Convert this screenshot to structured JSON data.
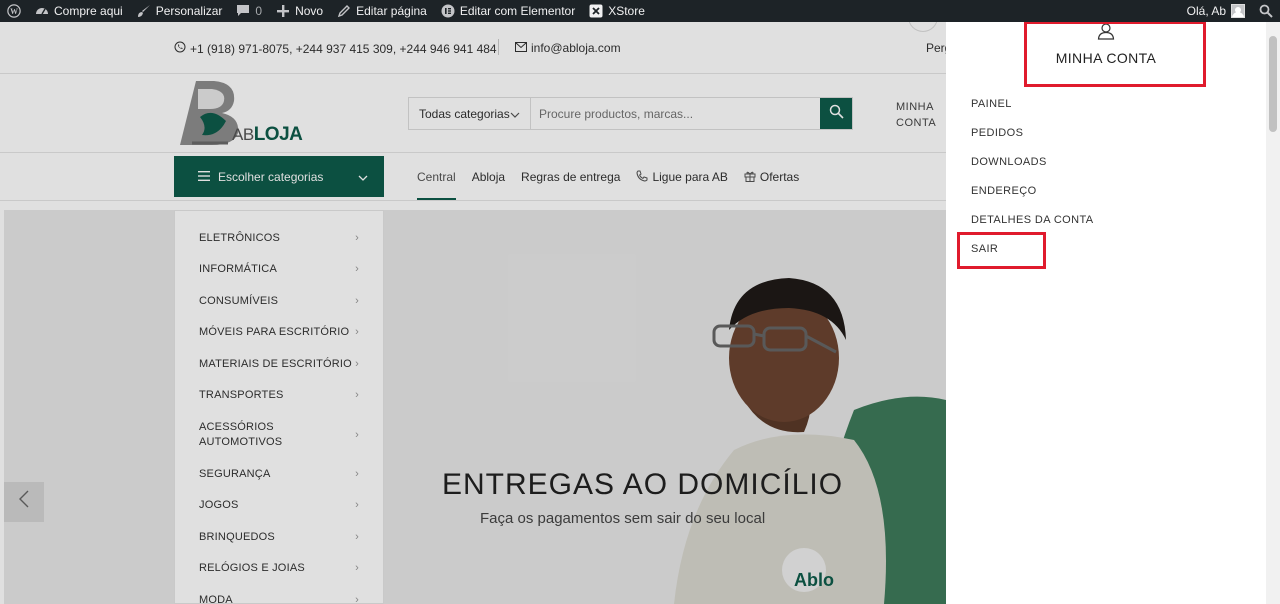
{
  "adminbar": {
    "items": [
      {
        "label": "",
        "icon": "wordpress-icon"
      },
      {
        "label": "Compre aqui",
        "icon": "dashboard-icon"
      },
      {
        "label": "Personalizar",
        "icon": "brush-icon"
      },
      {
        "label": "0",
        "icon": "comment-icon"
      },
      {
        "label": "Novo",
        "icon": "plus-icon"
      },
      {
        "label": "Editar página",
        "icon": "pencil-icon"
      },
      {
        "label": "Editar com Elementor",
        "icon": "elementor-icon"
      },
      {
        "label": "XStore",
        "icon": "xstore-icon"
      }
    ],
    "greeting": "Olá, Ab"
  },
  "topinfo": {
    "phones": "+1 (918) 971-8075, +244 937 415 309, +244 946 941 484",
    "email": "info@abloja.com",
    "perg": "Perg"
  },
  "header": {
    "logo_text_ab": "AB",
    "logo_text_loja": "LOJA",
    "search_category": "Todas categorias",
    "search_placeholder": "Procure productos, marcas...",
    "account_line1": "MINHA",
    "account_line2": "CONTA"
  },
  "nav": {
    "categories_button": "Escolher categorias",
    "menu": [
      {
        "label": "Central",
        "active": true,
        "icon": ""
      },
      {
        "label": "Abloja",
        "active": false,
        "icon": ""
      },
      {
        "label": "Regras de entrega",
        "active": false,
        "icon": ""
      },
      {
        "label": "Ligue para AB",
        "active": false,
        "icon": "phone-icon"
      },
      {
        "label": "Ofertas",
        "active": false,
        "icon": "gift-icon"
      }
    ]
  },
  "categories": [
    "ELETRÔNICOS",
    "INFORMÁTICA",
    "CONSUMÍVEIS",
    "MÓVEIS PARA ESCRITÓRIO",
    "MATERIAIS DE ESCRITÓRIO",
    "TRANSPORTES",
    "ACESSÓRIOS\nAUTOMOTIVOS",
    "SEGURANÇA",
    "JOGOS",
    "BRINQUEDOS",
    "RELÓGIOS E JOIAS",
    "MODA"
  ],
  "hero": {
    "title": "ENTREGAS AO DOMICÍLIO",
    "subtitle": "Faça os pagamentos sem sair do seu local",
    "shirt_logo": "Ablo"
  },
  "account_panel": {
    "title": "MINHA CONTA",
    "links": [
      "PAINEL",
      "PEDIDOS",
      "DOWNLOADS",
      "ENDEREÇO",
      "DETALHES DA CONTA",
      "SAIR"
    ]
  },
  "colors": {
    "brand": "#0e5c4a",
    "highlight": "#e01b2d",
    "adminbar": "#1d2327"
  }
}
